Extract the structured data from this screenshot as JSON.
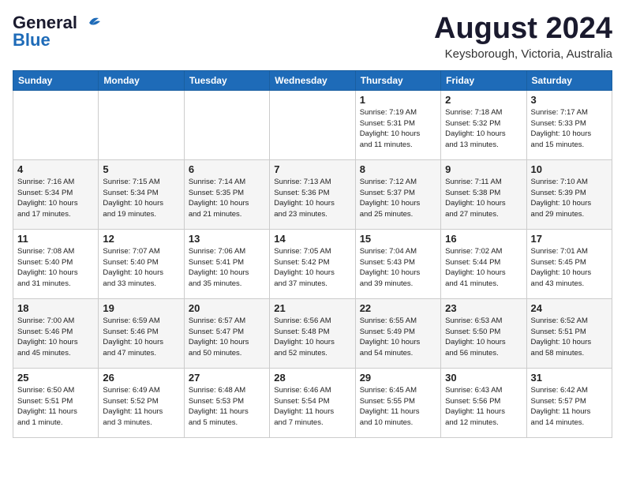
{
  "header": {
    "logo_general": "General",
    "logo_blue": "Blue",
    "month": "August 2024",
    "location": "Keysborough, Victoria, Australia"
  },
  "weekdays": [
    "Sunday",
    "Monday",
    "Tuesday",
    "Wednesday",
    "Thursday",
    "Friday",
    "Saturday"
  ],
  "weeks": [
    [
      {
        "day": "",
        "info": ""
      },
      {
        "day": "",
        "info": ""
      },
      {
        "day": "",
        "info": ""
      },
      {
        "day": "",
        "info": ""
      },
      {
        "day": "1",
        "info": "Sunrise: 7:19 AM\nSunset: 5:31 PM\nDaylight: 10 hours\nand 11 minutes."
      },
      {
        "day": "2",
        "info": "Sunrise: 7:18 AM\nSunset: 5:32 PM\nDaylight: 10 hours\nand 13 minutes."
      },
      {
        "day": "3",
        "info": "Sunrise: 7:17 AM\nSunset: 5:33 PM\nDaylight: 10 hours\nand 15 minutes."
      }
    ],
    [
      {
        "day": "4",
        "info": "Sunrise: 7:16 AM\nSunset: 5:34 PM\nDaylight: 10 hours\nand 17 minutes."
      },
      {
        "day": "5",
        "info": "Sunrise: 7:15 AM\nSunset: 5:34 PM\nDaylight: 10 hours\nand 19 minutes."
      },
      {
        "day": "6",
        "info": "Sunrise: 7:14 AM\nSunset: 5:35 PM\nDaylight: 10 hours\nand 21 minutes."
      },
      {
        "day": "7",
        "info": "Sunrise: 7:13 AM\nSunset: 5:36 PM\nDaylight: 10 hours\nand 23 minutes."
      },
      {
        "day": "8",
        "info": "Sunrise: 7:12 AM\nSunset: 5:37 PM\nDaylight: 10 hours\nand 25 minutes."
      },
      {
        "day": "9",
        "info": "Sunrise: 7:11 AM\nSunset: 5:38 PM\nDaylight: 10 hours\nand 27 minutes."
      },
      {
        "day": "10",
        "info": "Sunrise: 7:10 AM\nSunset: 5:39 PM\nDaylight: 10 hours\nand 29 minutes."
      }
    ],
    [
      {
        "day": "11",
        "info": "Sunrise: 7:08 AM\nSunset: 5:40 PM\nDaylight: 10 hours\nand 31 minutes."
      },
      {
        "day": "12",
        "info": "Sunrise: 7:07 AM\nSunset: 5:40 PM\nDaylight: 10 hours\nand 33 minutes."
      },
      {
        "day": "13",
        "info": "Sunrise: 7:06 AM\nSunset: 5:41 PM\nDaylight: 10 hours\nand 35 minutes."
      },
      {
        "day": "14",
        "info": "Sunrise: 7:05 AM\nSunset: 5:42 PM\nDaylight: 10 hours\nand 37 minutes."
      },
      {
        "day": "15",
        "info": "Sunrise: 7:04 AM\nSunset: 5:43 PM\nDaylight: 10 hours\nand 39 minutes."
      },
      {
        "day": "16",
        "info": "Sunrise: 7:02 AM\nSunset: 5:44 PM\nDaylight: 10 hours\nand 41 minutes."
      },
      {
        "day": "17",
        "info": "Sunrise: 7:01 AM\nSunset: 5:45 PM\nDaylight: 10 hours\nand 43 minutes."
      }
    ],
    [
      {
        "day": "18",
        "info": "Sunrise: 7:00 AM\nSunset: 5:46 PM\nDaylight: 10 hours\nand 45 minutes."
      },
      {
        "day": "19",
        "info": "Sunrise: 6:59 AM\nSunset: 5:46 PM\nDaylight: 10 hours\nand 47 minutes."
      },
      {
        "day": "20",
        "info": "Sunrise: 6:57 AM\nSunset: 5:47 PM\nDaylight: 10 hours\nand 50 minutes."
      },
      {
        "day": "21",
        "info": "Sunrise: 6:56 AM\nSunset: 5:48 PM\nDaylight: 10 hours\nand 52 minutes."
      },
      {
        "day": "22",
        "info": "Sunrise: 6:55 AM\nSunset: 5:49 PM\nDaylight: 10 hours\nand 54 minutes."
      },
      {
        "day": "23",
        "info": "Sunrise: 6:53 AM\nSunset: 5:50 PM\nDaylight: 10 hours\nand 56 minutes."
      },
      {
        "day": "24",
        "info": "Sunrise: 6:52 AM\nSunset: 5:51 PM\nDaylight: 10 hours\nand 58 minutes."
      }
    ],
    [
      {
        "day": "25",
        "info": "Sunrise: 6:50 AM\nSunset: 5:51 PM\nDaylight: 11 hours\nand 1 minute."
      },
      {
        "day": "26",
        "info": "Sunrise: 6:49 AM\nSunset: 5:52 PM\nDaylight: 11 hours\nand 3 minutes."
      },
      {
        "day": "27",
        "info": "Sunrise: 6:48 AM\nSunset: 5:53 PM\nDaylight: 11 hours\nand 5 minutes."
      },
      {
        "day": "28",
        "info": "Sunrise: 6:46 AM\nSunset: 5:54 PM\nDaylight: 11 hours\nand 7 minutes."
      },
      {
        "day": "29",
        "info": "Sunrise: 6:45 AM\nSunset: 5:55 PM\nDaylight: 11 hours\nand 10 minutes."
      },
      {
        "day": "30",
        "info": "Sunrise: 6:43 AM\nSunset: 5:56 PM\nDaylight: 11 hours\nand 12 minutes."
      },
      {
        "day": "31",
        "info": "Sunrise: 6:42 AM\nSunset: 5:57 PM\nDaylight: 11 hours\nand 14 minutes."
      }
    ]
  ]
}
